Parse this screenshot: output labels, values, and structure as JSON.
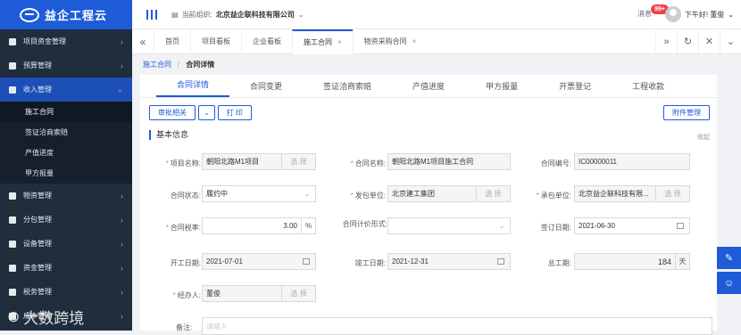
{
  "app": {
    "name": "益企工程云"
  },
  "sidebar": {
    "items": [
      {
        "label": "项目资金管理",
        "icon": "wallet-icon"
      },
      {
        "label": "预算管理",
        "icon": "calculator-icon"
      },
      {
        "label": "收入管理",
        "icon": "income-icon"
      },
      {
        "label": "物资管理",
        "icon": "material-icon"
      },
      {
        "label": "分包管理",
        "icon": "subcontract-icon"
      },
      {
        "label": "设备管理",
        "icon": "equipment-icon"
      },
      {
        "label": "资金管理",
        "icon": "fund-icon"
      },
      {
        "label": "税务管理",
        "icon": "tax-icon"
      },
      {
        "label": "成本管理",
        "icon": "cost-icon"
      }
    ],
    "sub_items": [
      "施工合同",
      "签证洽商索赔",
      "产值进度",
      "甲方报量"
    ],
    "watermark": "大数跨境"
  },
  "header": {
    "org_label": "当前组织:",
    "org_name": "北京益企联科技有限公司",
    "messages_label": "消息",
    "messages_badge": "99+",
    "user_greeting": "下午好! 董俊"
  },
  "tabs": [
    {
      "label": "首页",
      "closable": false
    },
    {
      "label": "项目看板",
      "closable": false
    },
    {
      "label": "企业看板",
      "closable": false
    },
    {
      "label": "施工合同",
      "closable": true
    },
    {
      "label": "物资采购合同",
      "closable": true
    }
  ],
  "breadcrumb": {
    "parent": "施工合同",
    "current": "合同详情"
  },
  "subtabs": [
    "合同详情",
    "合同变更",
    "签证洽商索赔",
    "产值进度",
    "甲方报量",
    "开票登记",
    "工程收款"
  ],
  "toolbar": {
    "approve": "审批相关",
    "print": "打 印",
    "attachments": "附件管理"
  },
  "section": {
    "title": "基本信息",
    "collapse": "收起"
  },
  "form": {
    "project_name": {
      "label": "项目名称:",
      "value": "朝阳北路M1项目",
      "pick": "选 择"
    },
    "contract_name": {
      "label": "合同名称:",
      "value": "朝阳北路M1项目施工合同"
    },
    "contract_no": {
      "label": "合同编号:",
      "value": "IC00000011"
    },
    "status": {
      "label": "合同状态:",
      "value": "履约中"
    },
    "issuer": {
      "label": "发包单位:",
      "value": "北京建工集团",
      "pick": "选 择"
    },
    "contractor": {
      "label": "承包单位:",
      "value": "北京益企联科技有限...",
      "pick": "选 择"
    },
    "tax_rate": {
      "label": "合同税率:",
      "value": "3.00",
      "unit": "%"
    },
    "pricing": {
      "label": "合同计价形式:",
      "value": ""
    },
    "sign_date": {
      "label": "签订日期:",
      "value": "2021-06-30"
    },
    "start_date": {
      "label": "开工日期:",
      "value": "2021-07-01"
    },
    "end_date": {
      "label": "竣工日期:",
      "value": "2021-12-31"
    },
    "total_days": {
      "label": "总工期:",
      "value": "184",
      "unit": "天"
    },
    "handler": {
      "label": "经办人:",
      "value": "董俊",
      "pick": "选 择"
    },
    "remark": {
      "label": "备注:",
      "placeholder": "请输入"
    }
  },
  "colors": {
    "primary": "#1e5bd8",
    "sidebar": "#1f2d3d"
  }
}
